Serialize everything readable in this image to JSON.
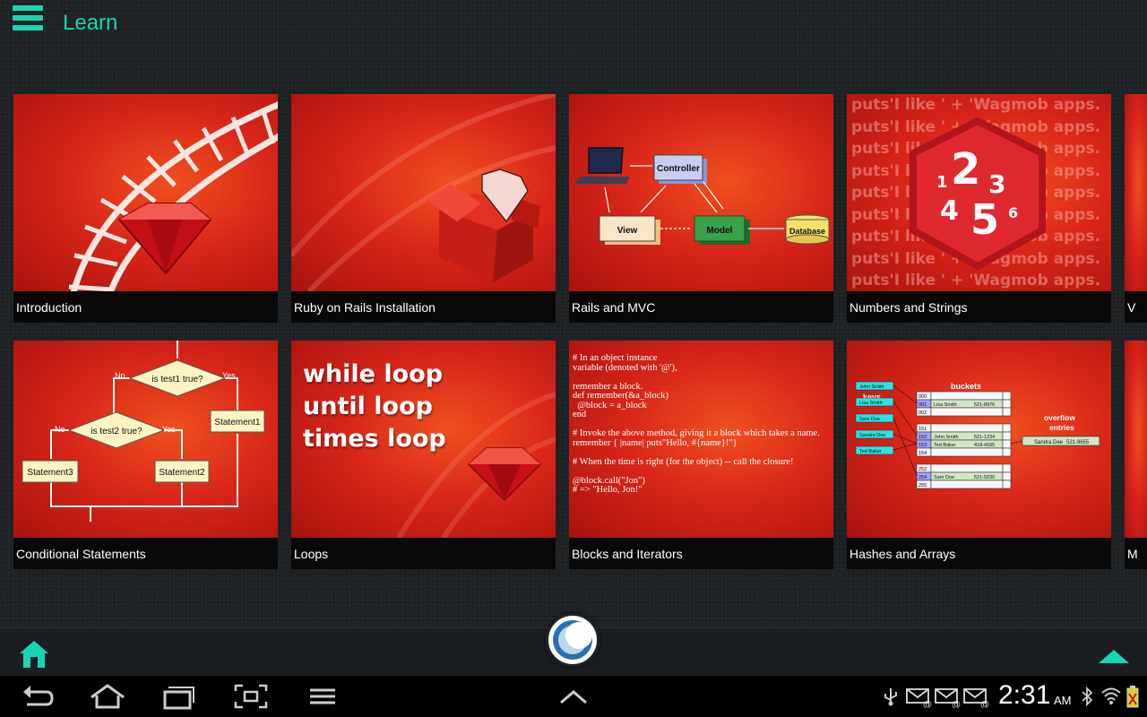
{
  "app": {
    "title": "Learn"
  },
  "tiles": [
    {
      "label": "Introduction"
    },
    {
      "label": "Ruby on Rails Installation"
    },
    {
      "label": "Rails and MVC"
    },
    {
      "label": "Numbers and Strings"
    },
    {
      "label": "V"
    },
    {
      "label": "Conditional Statements"
    },
    {
      "label": "Loops"
    },
    {
      "label": "Blocks and Iterators"
    },
    {
      "label": "Hashes and Arrays"
    },
    {
      "label": "M"
    }
  ],
  "thumbs": {
    "mvc": {
      "controller": "Controller",
      "view": "View",
      "model": "Model",
      "database": "Database"
    },
    "numbers": {
      "background_line": "puts'I like ' + 'Wagmob apps.",
      "digits": [
        "1",
        "2",
        "3",
        "4",
        "5",
        "6"
      ]
    },
    "conditional": {
      "test1": "is test1 true?",
      "test2": "is test2 true?",
      "no": "No",
      "yes": "Yes",
      "statement1": "Statement1",
      "statement2": "Statement2",
      "statement3": "Statement3"
    },
    "loops": {
      "lines": [
        "while loop",
        "until loop",
        "times loop"
      ]
    },
    "blocks": {
      "code": "# In an object instance\nvariable (denoted with '@'),\n\nremember a block.\ndef remember(&a_block)\n  @block = a_block\nend\n\n# Invoke the above method, giving it a block which takes a name.\nremember { |name| puts\"Hello, #{name}!\"}\n\n# When the time is right (for the object) -- call the closure!\n\n@block.call(\"Jon\")\n# => \"Hello, Jon!\""
    },
    "hashes": {
      "keys_label": "keys",
      "buckets_label": "buckets",
      "overflow_label": "overflow",
      "entries_label": "entries",
      "keys": [
        "John Smith",
        "Lisa Smith",
        "Sam Doe",
        "Sandra Dee",
        "Ted Baker"
      ],
      "buckets": [
        {
          "index": "000",
          "name": "",
          "number": ""
        },
        {
          "index": "001",
          "name": "Lisa Smith",
          "number": "521-8976"
        },
        {
          "index": "002",
          "name": "",
          "number": ""
        },
        {
          "index": "151",
          "name": "",
          "number": ""
        },
        {
          "index": "152",
          "name": "John Smith",
          "number": "521-1234"
        },
        {
          "index": "153",
          "name": "Ted Baker",
          "number": "418-4165"
        },
        {
          "index": "154",
          "name": "",
          "number": ""
        },
        {
          "index": "253",
          "name": "",
          "number": ""
        },
        {
          "index": "254",
          "name": "Sam Doe",
          "number": "521-5030"
        },
        {
          "index": "255",
          "name": "",
          "number": ""
        }
      ],
      "overflow_entry": {
        "name": "Sandra Dee",
        "number": "521-9655"
      }
    }
  },
  "status": {
    "time": "2:31",
    "ampm": "AM"
  },
  "colors": {
    "accent": "#17d6b3",
    "tile_red": "#d9271b",
    "caption_bg": "#080808"
  },
  "icons": {
    "menu": "hamburger-icon",
    "home": "home-icon",
    "up": "triangle-up-icon",
    "back": "back-arrow-icon",
    "recent": "recent-apps-icon",
    "screenshot": "screen-capture-icon",
    "menu_soft": "menu-lines-icon",
    "usb": "usb-icon",
    "mail": "mail-icon",
    "bluetooth": "bluetooth-icon",
    "wifi": "wifi-icon",
    "battery": "battery-icon"
  }
}
